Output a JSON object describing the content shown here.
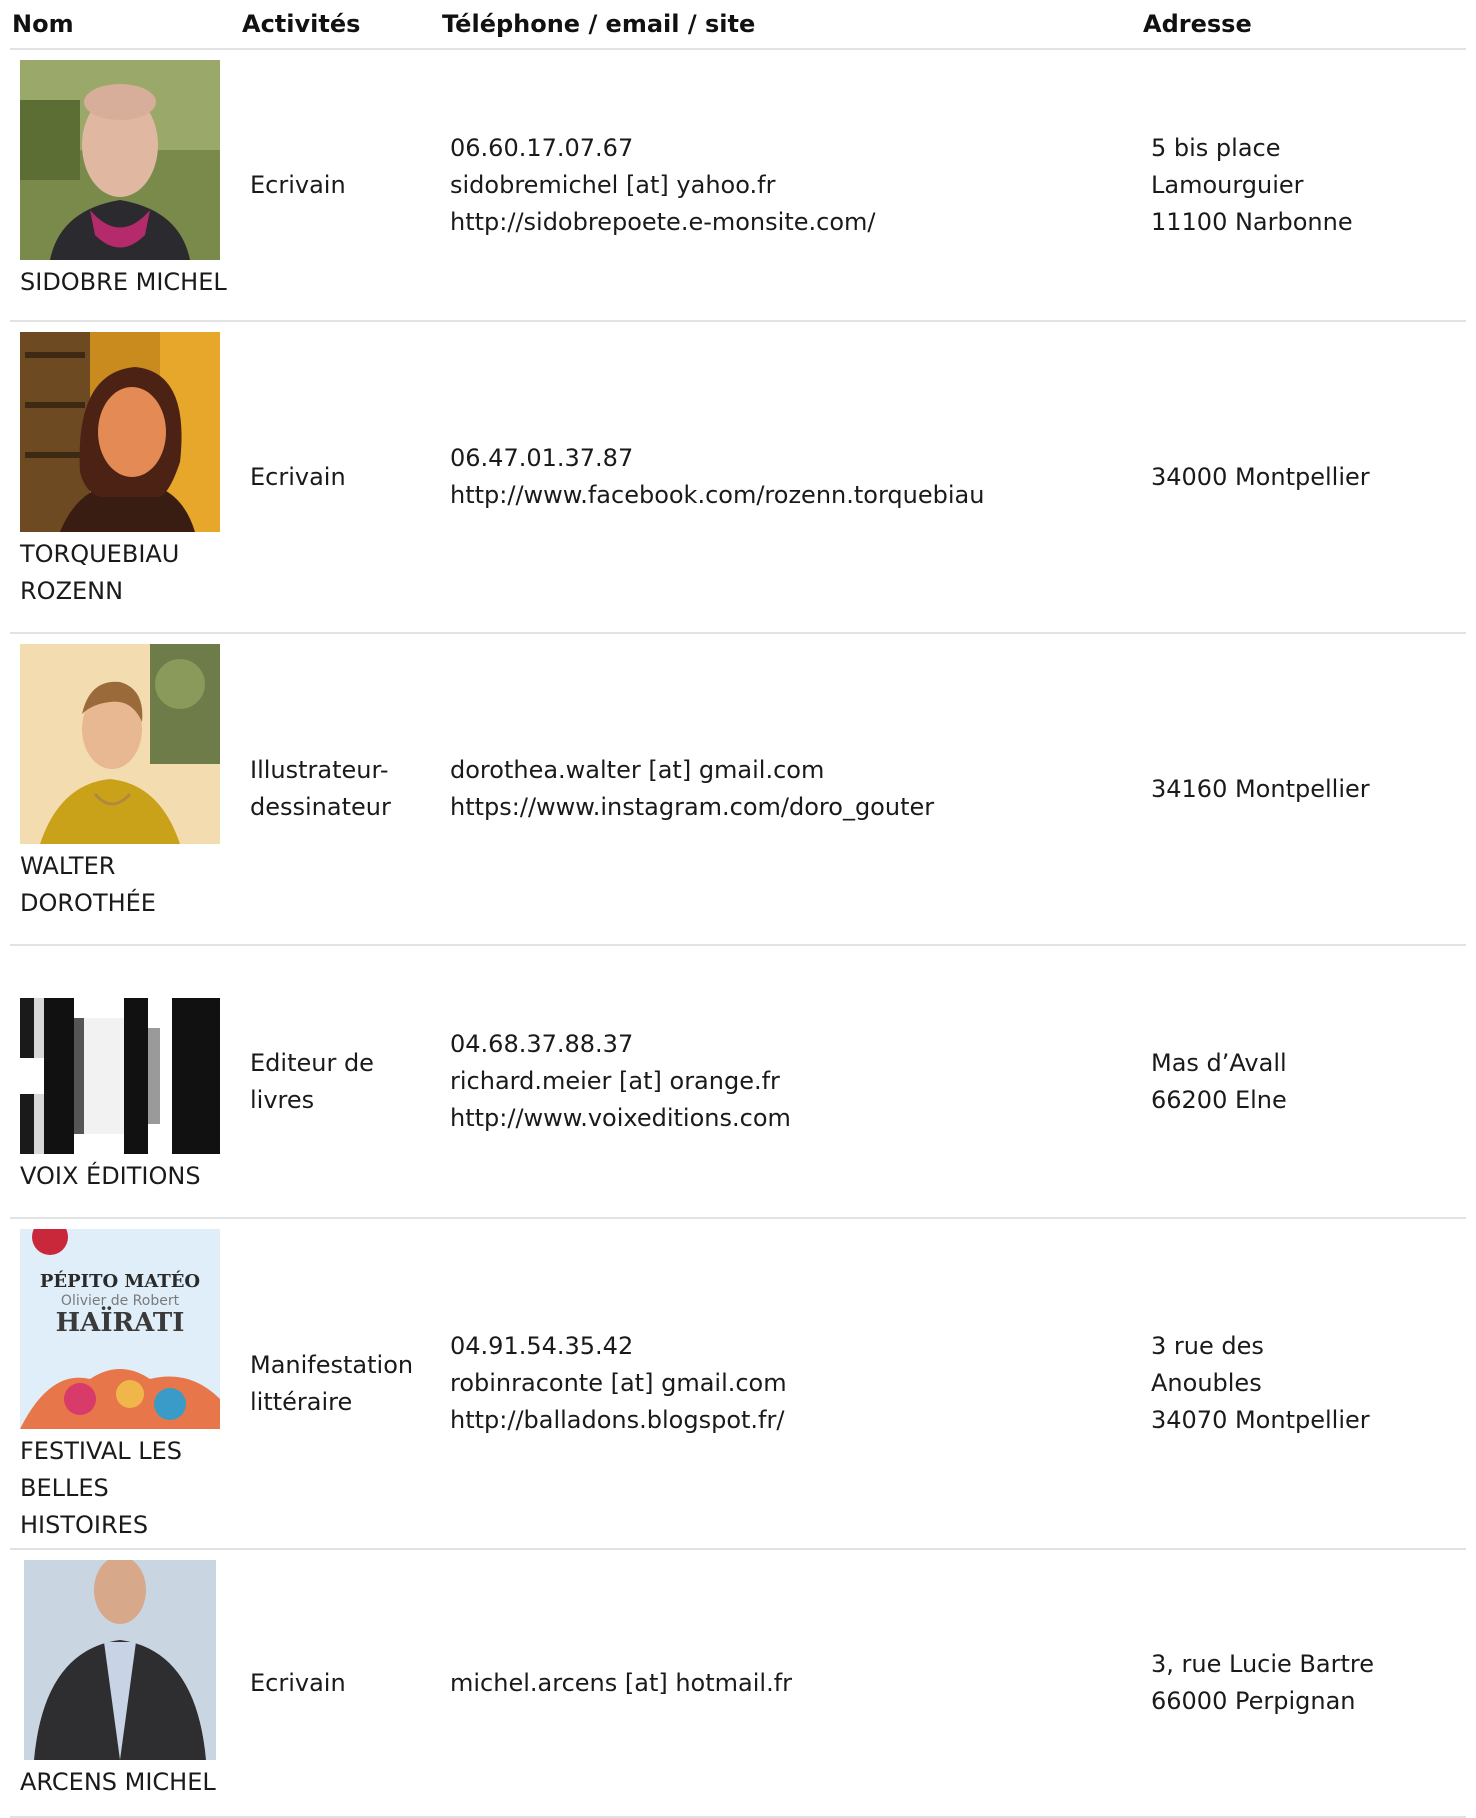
{
  "headers": {
    "name": "Nom",
    "activity": "Activités",
    "contact": "Téléphone / email / site",
    "address": "Adresse"
  },
  "rows": [
    {
      "name": "SIDOBRE MICHEL",
      "photo": "portrait-photo",
      "activity": "Ecrivain",
      "contact": [
        "06.60.17.07.67",
        "sidobremichel [at] yahoo.fr",
        "http://sidobrepoete.e-monsite.com/"
      ],
      "address": [
        "5 bis place",
        "Lamourguier",
        "11100 Narbonne"
      ]
    },
    {
      "name": "TORQUEBIAU ROZENN",
      "photo": "portrait-photo",
      "activity": "Ecrivain",
      "contact": [
        "06.47.01.37.87",
        "http://www.facebook.com/rozenn.torquebiau"
      ],
      "address": [
        "34000 Montpellier"
      ]
    },
    {
      "name": "WALTER DOROTHÉE",
      "photo": "portrait-photo",
      "activity": "Illustrateur-dessinateur",
      "contact": [
        "dorothea.walter [at] gmail.com",
        "https://www.instagram.com/doro_gouter"
      ],
      "address": [
        "34160 Montpellier"
      ]
    },
    {
      "name": "VOIX ÉDITIONS",
      "photo": "logo-image",
      "activity": "Editeur de livres",
      "contact": [
        "04.68.37.88.37",
        "richard.meier [at] orange.fr",
        "http://www.voixeditions.com"
      ],
      "address": [
        "Mas d’Avall",
        "66200 Elne"
      ]
    },
    {
      "name": "FESTIVAL LES BELLES HISTOIRES",
      "photo": "poster-image",
      "poster_text": [
        "PÉPITO MATÉO",
        "Olivier de Robert",
        "HAÏRATI"
      ],
      "activity": "Manifestation littéraire",
      "contact": [
        "04.91.54.35.42",
        "robinraconte [at] gmail.com",
        "http://balladons.blogspot.fr/"
      ],
      "address": [
        "3 rue des",
        "Anoubles",
        "34070 Montpellier"
      ]
    },
    {
      "name": "ARCENS MICHEL",
      "photo": "portrait-photo",
      "activity": "Ecrivain",
      "contact": [
        "michel.arcens [at] hotmail.fr"
      ],
      "address": [
        "3, rue Lucie Bartre",
        "66000 Perpignan"
      ]
    }
  ]
}
